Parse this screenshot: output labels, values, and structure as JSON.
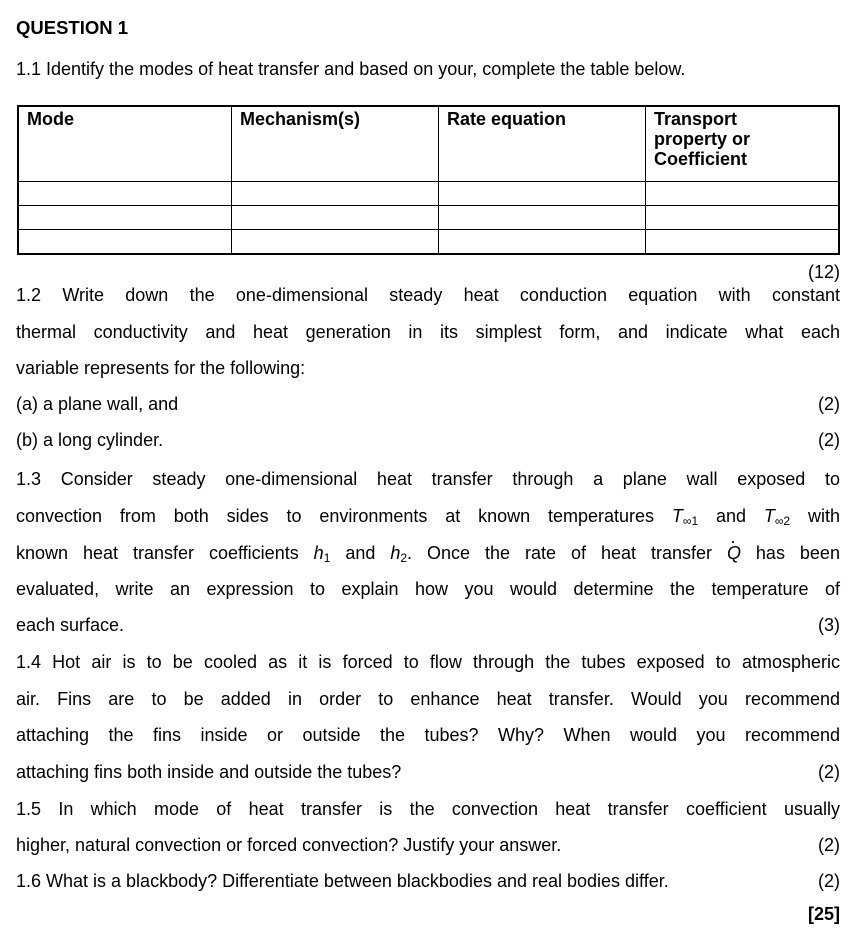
{
  "question_title": "QUESTION 1",
  "q1_1": {
    "text": "1.1 Identify the modes of heat transfer and based on your, complete the table below.",
    "table": {
      "headers": [
        "Mode",
        "Mechanism(s)",
        "Rate equation",
        "Transport property or Coefficient"
      ],
      "header_lines_col4": [
        "Transport",
        "property or",
        "Coefficient"
      ],
      "rows": [
        [
          "",
          "",
          "",
          ""
        ],
        [
          "",
          "",
          "",
          ""
        ],
        [
          "",
          "",
          "",
          ""
        ]
      ]
    },
    "marks": "(12)"
  },
  "q1_2": {
    "lines": [
      "1.2 Write down the one-dimensional steady heat conduction equation with constant",
      "thermal conductivity and heat generation in its simplest form, and indicate what each",
      "variable represents for the following:"
    ],
    "parts": [
      {
        "text": "(a) a plane wall, and",
        "marks": "(2)"
      },
      {
        "text": "(b) a long cylinder.",
        "marks": "(2)"
      }
    ]
  },
  "q1_3": {
    "line1": "1.3 Consider steady one-dimensional heat transfer through a plane wall exposed to",
    "line2_a": "convection from both sides to environments at known temperatures ",
    "T_inf1": "T",
    "T_inf1_sub": "∞1",
    "line2_b": " and ",
    "T_inf2": "T",
    "T_inf2_sub": "∞2",
    "line2_c": " with",
    "line3_a": "known heat transfer coefficients ",
    "h1": "h",
    "h1_sub": "1",
    "line3_b": " and ",
    "h2": "h",
    "h2_sub": "2",
    "line3_c": ". Once the rate of heat transfer ",
    "Q": "Q",
    "line3_d": " has been",
    "line4": "evaluated, write an expression to explain how you would determine the temperature of",
    "line5": "each surface.",
    "marks": "(3)"
  },
  "q1_4": {
    "lines": [
      "1.4 Hot air is to be cooled as it is forced to flow through the tubes exposed to atmospheric",
      "air. Fins are to be added in order to enhance heat transfer. Would you recommend",
      "attaching the fins inside or outside the tubes? Why? When would you recommend",
      "attaching fins both inside and outside the tubes?"
    ],
    "marks": "(2)"
  },
  "q1_5": {
    "lines": [
      "1.5 In which mode of heat transfer is the convection heat transfer coefficient usually",
      "higher, natural convection or forced convection? Justify your answer."
    ],
    "marks": "(2)"
  },
  "q1_6": {
    "text": "1.6 What is a blackbody? Differentiate between blackbodies and real bodies differ.",
    "marks": "(2)"
  },
  "total": "[25]"
}
